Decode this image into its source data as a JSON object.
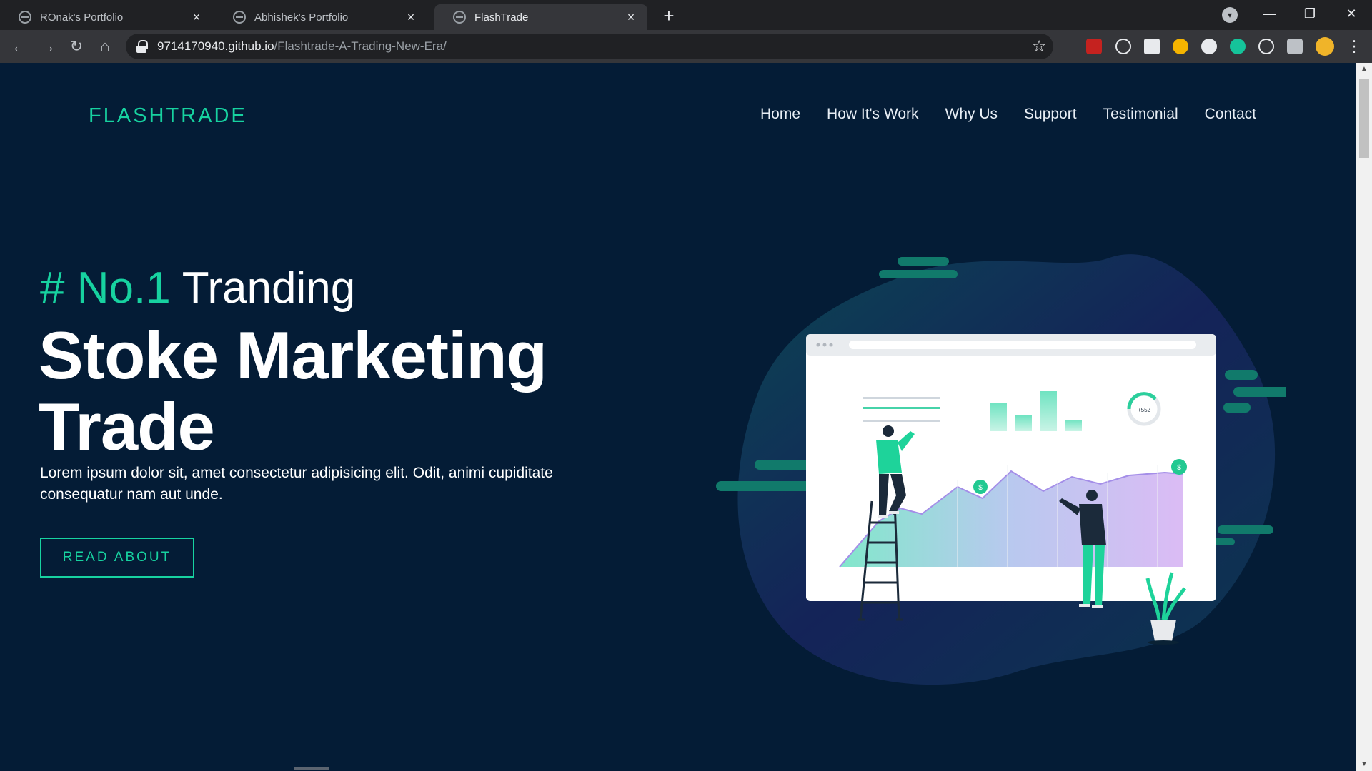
{
  "browser": {
    "tabs": [
      {
        "title": "ROnak's Portfolio"
      },
      {
        "title": "Abhishek's Portfolio"
      },
      {
        "title": "FlashTrade"
      }
    ],
    "new_tab_label": "+",
    "url_host": "9714170940.github.io",
    "url_path": "/Flashtrade-A-Trading-New-Era/"
  },
  "site": {
    "logo": "FLASHTRADE",
    "nav": [
      "Home",
      "How It's Work",
      "Why Us",
      "Support",
      "Testimonial",
      "Contact"
    ]
  },
  "hero": {
    "kicker_accent": "# No.1",
    "kicker_rest": "Tranding",
    "title_line1": "Stoke Marketing",
    "title_line2": "Trade",
    "description": "Lorem ipsum dolor sit, amet consectetur adipisicing elit. Odit, animi cupiditate consequatur nam aut unde.",
    "cta_label": "READ ABOUT"
  },
  "illustration": {
    "gauge_value": "+552",
    "coin_symbol": "$"
  },
  "colors": {
    "page_bg": "#041c36",
    "accent": "#17d2a0",
    "chrome_dark": "#202124",
    "chrome_toolbar": "#35363a"
  }
}
